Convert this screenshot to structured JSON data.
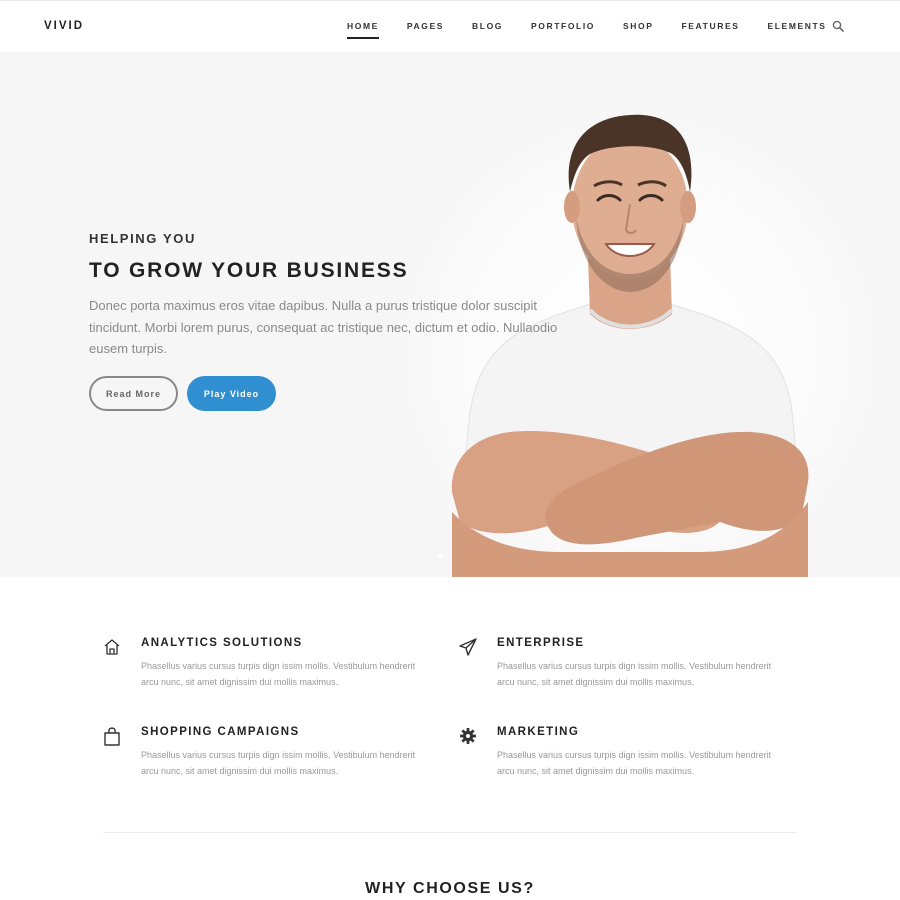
{
  "nav": {
    "logo": "VIVID",
    "items": [
      {
        "label": "HOME",
        "active": true
      },
      {
        "label": "PAGES"
      },
      {
        "label": "BLOG"
      },
      {
        "label": "PORTFOLIO"
      },
      {
        "label": "SHOP"
      },
      {
        "label": "FEATURES"
      },
      {
        "label": "ELEMENTS"
      }
    ],
    "search_icon": "search-icon"
  },
  "hero": {
    "subtitle": "HELPING YOU",
    "title": "TO GROW YOUR BUSINESS",
    "description": "Donec porta maximus eros vitae dapibus. Nulla a purus tristique dolor suscipit tincidunt. Morbi lorem purus, consequat ac tristique nec, dictum et odio. Nullaodio eusem turpis.",
    "read_more": "Read More",
    "play_video": "Play Video",
    "accent_color": "#2f8fd0"
  },
  "features": [
    {
      "icon": "home-icon",
      "title": "ANALYTICS SOLUTIONS",
      "text": "Phasellus varius cursus turpis dign issim mollis. Vestibulum hendrerit arcu nunc, sit amet dignissim dui mollis maximus."
    },
    {
      "icon": "paper-plane-icon",
      "title": "ENTERPRISE",
      "text": "Phasellus varius cursus turpis dign issim mollis. Vestibulum hendrerit arcu nunc, sit amet dignissim dui mollis maximus."
    },
    {
      "icon": "shopping-bag-icon",
      "title": "SHOPPING CAMPAIGNS",
      "text": "Phasellus varius cursus turpis dign issim mollis. Vestibulum hendrerit arcu nunc, sit amet dignissim dui mollis maximus."
    },
    {
      "icon": "gear-icon",
      "title": "MARKETING",
      "text": "Phasellus varius cursus turpis dign issim mollis. Vestibulum hendrerit arcu nunc, sit amet dignissim dui mollis maximus."
    }
  ],
  "section": {
    "why_title": "WHY CHOOSE US?"
  }
}
